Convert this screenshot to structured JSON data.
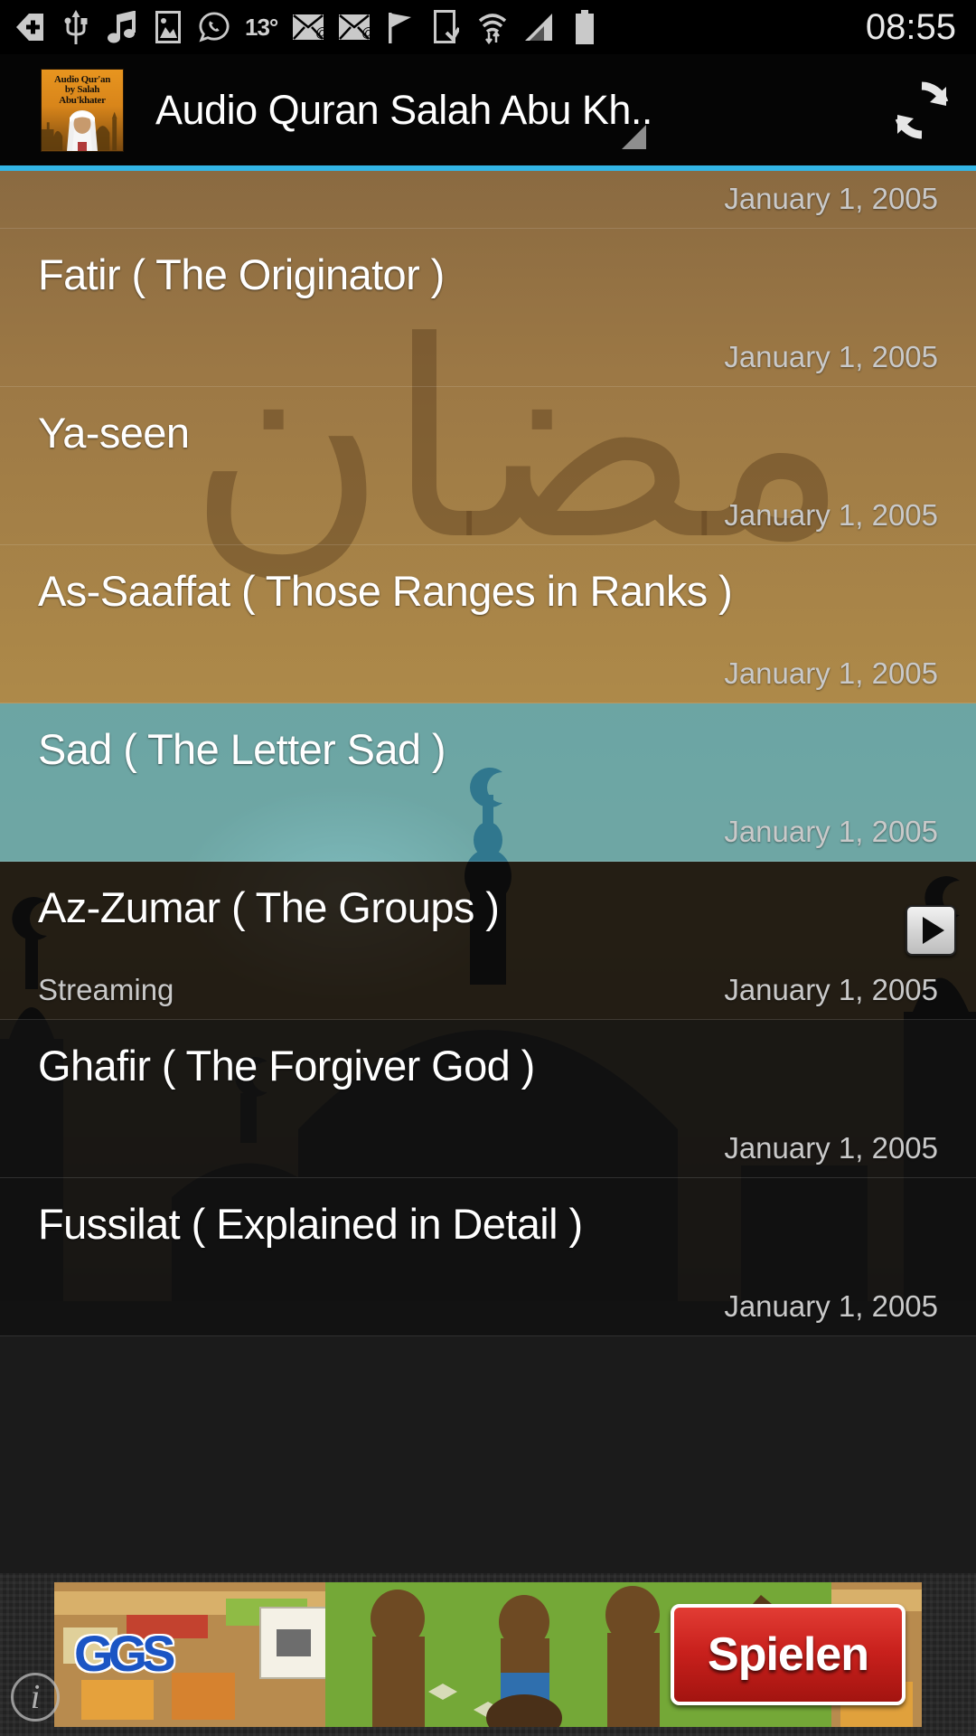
{
  "statusbar": {
    "time": "08:55",
    "temperature": "13°",
    "icons": [
      {
        "name": "back-plus-icon"
      },
      {
        "name": "usb-icon"
      },
      {
        "name": "music-note-icon"
      },
      {
        "name": "image-icon"
      },
      {
        "name": "whatsapp-icon"
      },
      {
        "name": "temperature-label"
      },
      {
        "name": "email-at-icon"
      },
      {
        "name": "email-at-icon-2"
      },
      {
        "name": "flag-icon"
      },
      {
        "name": "phone-download-icon"
      },
      {
        "name": "wifi-icon"
      },
      {
        "name": "cell-signal-icon"
      },
      {
        "name": "battery-icon"
      }
    ]
  },
  "actionbar": {
    "title": "Audio Quran Salah Abu Kh..",
    "app_icon_line1": "Audio Qur'an",
    "app_icon_line2": "by Salah Abu'khater",
    "refresh_label": "refresh-icon",
    "accent_color": "#33b5e5"
  },
  "list": {
    "top_partial_date": "January 1, 2005",
    "items": [
      {
        "title": "Fatir ( The Originator )",
        "date": "January 1, 2005",
        "subtitle": "",
        "selected": false,
        "playing": false
      },
      {
        "title": "Ya-seen",
        "date": "January 1, 2005",
        "subtitle": "",
        "selected": false,
        "playing": false
      },
      {
        "title": "As-Saaffat ( Those Ranges in Ranks )",
        "date": "January 1, 2005",
        "subtitle": "",
        "selected": false,
        "playing": false
      },
      {
        "title": "Sad ( The Letter Sad )",
        "date": "January 1, 2005",
        "subtitle": "",
        "selected": true,
        "playing": false
      },
      {
        "title": "Az-Zumar ( The Groups )",
        "date": "January 1, 2005",
        "subtitle": "Streaming",
        "selected": false,
        "playing": true
      },
      {
        "title": "Ghafir ( The Forgiver God )",
        "date": "January 1, 2005",
        "subtitle": "",
        "selected": false,
        "playing": false
      },
      {
        "title": "Fussilat ( Explained in Detail )",
        "date": "January 1, 2005",
        "subtitle": "",
        "selected": false,
        "playing": false
      }
    ],
    "selected_color": "#44b7dc",
    "background_color": "#ad8949"
  },
  "ad": {
    "brand_logo": "GGS",
    "cta_label": "Spielen",
    "info_label": "i"
  }
}
